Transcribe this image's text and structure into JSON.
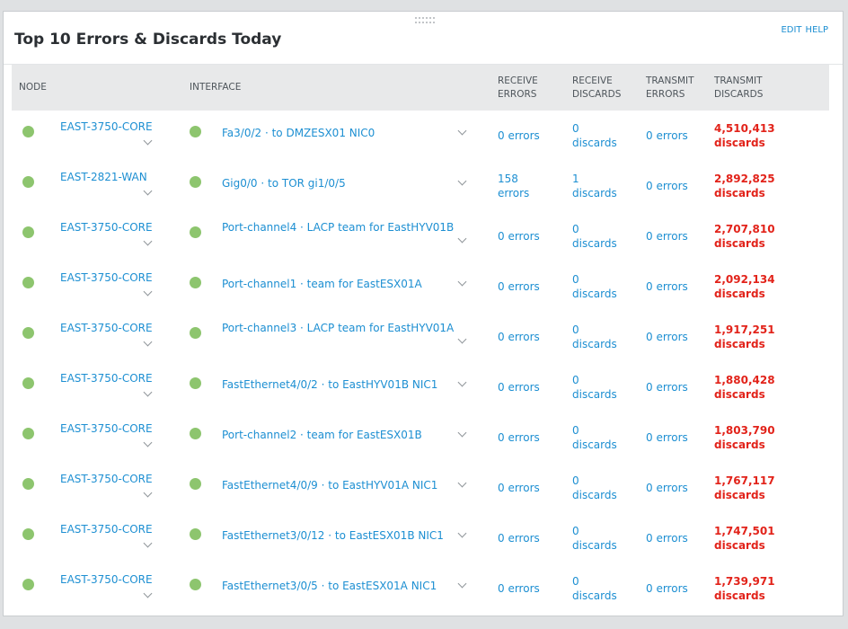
{
  "widget": {
    "title": "Top 10 Errors & Discards Today",
    "edit_label": "EDIT",
    "help_label": "HELP"
  },
  "columns": {
    "node": "NODE",
    "interface": "INTERFACE",
    "receive_errors": [
      "RECEIVE",
      "ERRORS"
    ],
    "receive_discards": [
      "RECEIVE",
      "DISCARDS"
    ],
    "transmit_errors": [
      "TRANSMIT",
      "ERRORS"
    ],
    "transmit_discards": [
      "TRANSMIT",
      "DISCARDS"
    ]
  },
  "colors": {
    "status_up": "#8dc56e",
    "link": "#1d8fd2",
    "alert": "#e2231a"
  },
  "rows": [
    {
      "node": "EAST-3750-CORE",
      "interface": "Fa3/0/2 · to DMZESX01 NIC0",
      "iface_wrap": false,
      "rx_errors": [
        "0 errors"
      ],
      "rx_discards": [
        "0",
        "discards"
      ],
      "tx_errors": [
        "0 errors"
      ],
      "tx_discards": [
        "4,510,413",
        "discards"
      ]
    },
    {
      "node": "EAST-2821-WAN",
      "interface": "Gig0/0 · to TOR gi1/0/5",
      "iface_wrap": false,
      "rx_errors": [
        "158",
        "errors"
      ],
      "rx_discards": [
        "1",
        "discards"
      ],
      "tx_errors": [
        "0 errors"
      ],
      "tx_discards": [
        "2,892,825",
        "discards"
      ]
    },
    {
      "node": "EAST-3750-CORE",
      "interface": "Port-channel4 · LACP team for EastHYV01B",
      "iface_wrap": true,
      "rx_errors": [
        "0 errors"
      ],
      "rx_discards": [
        "0",
        "discards"
      ],
      "tx_errors": [
        "0 errors"
      ],
      "tx_discards": [
        "2,707,810",
        "discards"
      ]
    },
    {
      "node": "EAST-3750-CORE",
      "interface": "Port-channel1 · team for EastESX01A",
      "iface_wrap": false,
      "rx_errors": [
        "0 errors"
      ],
      "rx_discards": [
        "0",
        "discards"
      ],
      "tx_errors": [
        "0 errors"
      ],
      "tx_discards": [
        "2,092,134",
        "discards"
      ]
    },
    {
      "node": "EAST-3750-CORE",
      "interface": "Port-channel3 · LACP team for EastHYV01A",
      "iface_wrap": true,
      "rx_errors": [
        "0 errors"
      ],
      "rx_discards": [
        "0",
        "discards"
      ],
      "tx_errors": [
        "0 errors"
      ],
      "tx_discards": [
        "1,917,251",
        "discards"
      ]
    },
    {
      "node": "EAST-3750-CORE",
      "interface": "FastEthernet4/0/2 · to EastHYV01B NIC1",
      "iface_wrap": false,
      "rx_errors": [
        "0 errors"
      ],
      "rx_discards": [
        "0",
        "discards"
      ],
      "tx_errors": [
        "0 errors"
      ],
      "tx_discards": [
        "1,880,428",
        "discards"
      ]
    },
    {
      "node": "EAST-3750-CORE",
      "interface": "Port-channel2 · team for EastESX01B",
      "iface_wrap": false,
      "rx_errors": [
        "0 errors"
      ],
      "rx_discards": [
        "0",
        "discards"
      ],
      "tx_errors": [
        "0 errors"
      ],
      "tx_discards": [
        "1,803,790",
        "discards"
      ]
    },
    {
      "node": "EAST-3750-CORE",
      "interface": "FastEthernet4/0/9 · to EastHYV01A NIC1",
      "iface_wrap": false,
      "rx_errors": [
        "0 errors"
      ],
      "rx_discards": [
        "0",
        "discards"
      ],
      "tx_errors": [
        "0 errors"
      ],
      "tx_discards": [
        "1,767,117",
        "discards"
      ]
    },
    {
      "node": "EAST-3750-CORE",
      "interface": "FastEthernet3/0/12 · to EastESX01B NIC1",
      "iface_wrap": false,
      "rx_errors": [
        "0 errors"
      ],
      "rx_discards": [
        "0",
        "discards"
      ],
      "tx_errors": [
        "0 errors"
      ],
      "tx_discards": [
        "1,747,501",
        "discards"
      ]
    },
    {
      "node": "EAST-3750-CORE",
      "interface": "FastEthernet3/0/5 · to EastESX01A NIC1",
      "iface_wrap": false,
      "rx_errors": [
        "0 errors"
      ],
      "rx_discards": [
        "0",
        "discards"
      ],
      "tx_errors": [
        "0 errors"
      ],
      "tx_discards": [
        "1,739,971",
        "discards"
      ]
    }
  ]
}
